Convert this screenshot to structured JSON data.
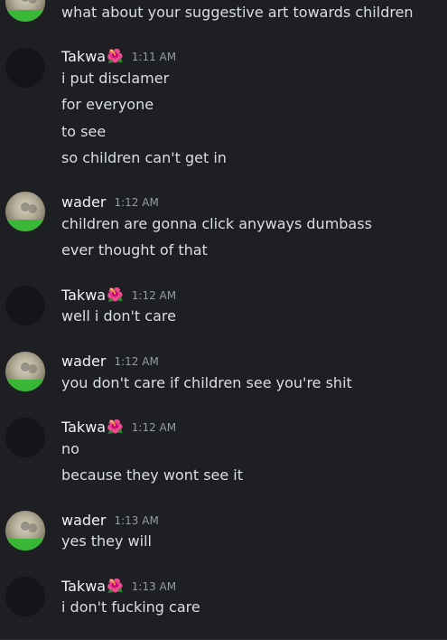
{
  "messages": [
    {
      "type": "continuation",
      "author": "wader",
      "lines": [
        "what about your suggestive art towards children"
      ]
    },
    {
      "type": "group",
      "author": "Takwa",
      "time": "1:11 AM",
      "lines": [
        "i put disclamer",
        "for everyone",
        "to see",
        "so children can't get in"
      ]
    },
    {
      "type": "group",
      "author": "wader",
      "time": "1:12 AM",
      "lines": [
        "children are gonna click anyways dumbass",
        "ever thought of that"
      ]
    },
    {
      "type": "group",
      "author": "Takwa",
      "time": "1:12 AM",
      "lines": [
        "well i don't care"
      ]
    },
    {
      "type": "group",
      "author": "wader",
      "time": "1:12 AM",
      "lines": [
        "you don't care if children see you're shit"
      ]
    },
    {
      "type": "group",
      "author": "Takwa",
      "time": "1:12 AM",
      "lines": [
        "no",
        "because they wont see it"
      ]
    },
    {
      "type": "group",
      "author": "wader",
      "time": "1:13 AM",
      "lines": [
        "yes they will"
      ]
    },
    {
      "type": "group",
      "author": "Takwa",
      "time": "1:13 AM",
      "lines": [
        "i don't fucking care"
      ]
    }
  ],
  "theme": {
    "background": "#1e1f22",
    "text": "#dbdee1",
    "muted": "#949ba4",
    "username": "#f2f3f5",
    "avatar_green": "#39b838"
  },
  "icons": {
    "flower": "hibiscus-flower-icon"
  }
}
